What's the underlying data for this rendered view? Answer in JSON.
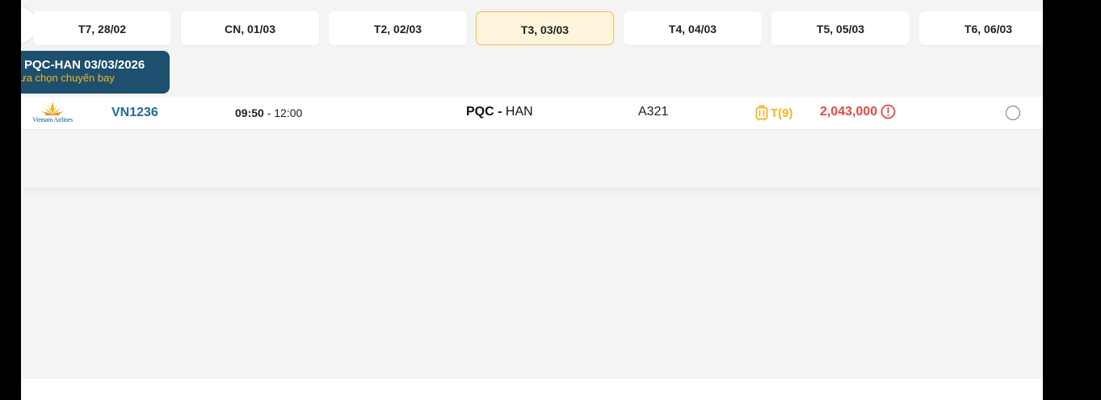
{
  "date_tabs": [
    {
      "label": "T7, 28/02",
      "active": false
    },
    {
      "label": "CN, 01/03",
      "active": false
    },
    {
      "label": "T2, 02/03",
      "active": false
    },
    {
      "label": "T3, 03/03",
      "active": true
    },
    {
      "label": "T4, 04/03",
      "active": false
    },
    {
      "label": "T5, 05/03",
      "active": false
    },
    {
      "label": "T6, 06/03",
      "active": false
    }
  ],
  "route_badge": {
    "title": "PQC-HAN 03/03/2026",
    "subtitle": "ưa chọn chuyến bay"
  },
  "flight": {
    "airline_name": "Vietnam Airlines",
    "flight_number": "VN1236",
    "depart_time": "09:50",
    "time_separator": " - ",
    "arrive_time": "12:00",
    "origin": "PQC",
    "route_separator": " - ",
    "destination": "HAN",
    "aircraft": "A321",
    "fare_class": "T(9)",
    "price": "2,043,000",
    "selected": false,
    "icons": {
      "seat": "luggage-icon",
      "price_info": "alert-circle-icon",
      "logo": "vietnam-airlines-lotus-logo"
    }
  },
  "colors": {
    "brand_blue": "#1d4f6e",
    "flight_number": "#1f6b8f",
    "accent_yellow": "#f0b620",
    "price_red": "#e04848",
    "active_tab_bg": "#fff5dc",
    "active_tab_border": "#f2c14b"
  }
}
